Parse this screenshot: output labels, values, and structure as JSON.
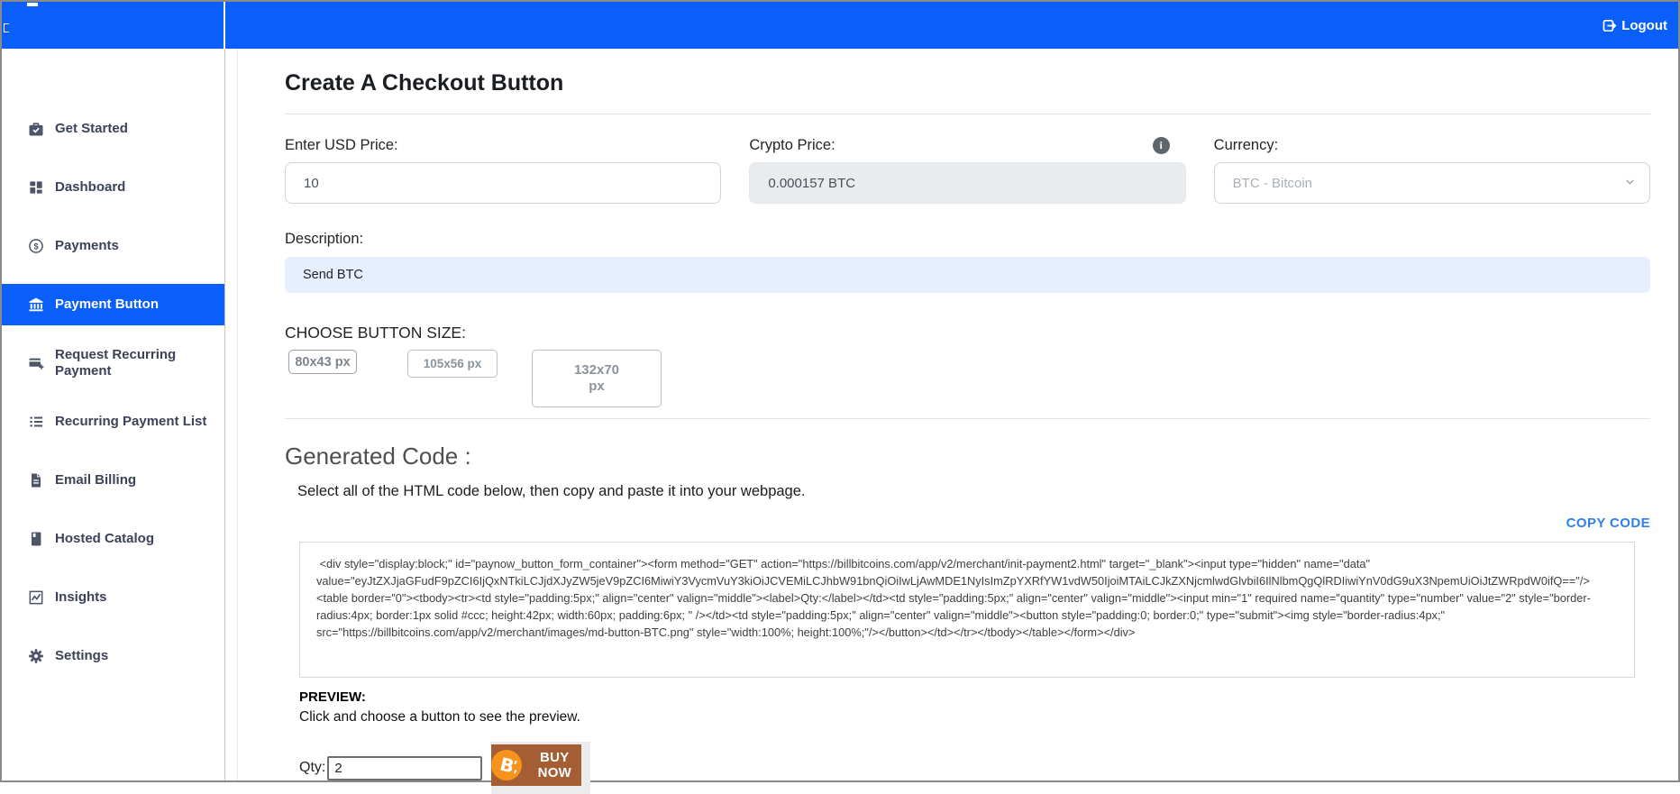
{
  "header": {
    "logout_label": "Logout",
    "bg_color": "#0a5ffa"
  },
  "sidebar": {
    "active_color": "#0a5ffa",
    "items": [
      {
        "label": "Get Started",
        "icon": "briefcase-check-icon",
        "active": false
      },
      {
        "label": "Dashboard",
        "icon": "dashboard-grid-icon",
        "active": false
      },
      {
        "label": "Payments",
        "icon": "dollar-circle-icon",
        "active": false
      },
      {
        "label": "Payment Button",
        "icon": "bank-icon",
        "active": true
      },
      {
        "label": "Request Recurring Payment",
        "icon": "card-plus-icon",
        "active": false
      },
      {
        "label": "Recurring Payment List",
        "icon": "list-icon",
        "active": false
      },
      {
        "label": "Email Billing",
        "icon": "document-icon",
        "active": false
      },
      {
        "label": "Hosted Catalog",
        "icon": "book-icon",
        "active": false
      },
      {
        "label": "Insights",
        "icon": "chart-line-icon",
        "active": false
      },
      {
        "label": "Settings",
        "icon": "gear-icon",
        "active": false
      }
    ]
  },
  "main": {
    "title": "Create A Checkout Button",
    "usd_price": {
      "label": "Enter USD Price:",
      "value": "10"
    },
    "crypto_price": {
      "label": "Crypto Price:",
      "value": "0.000157 BTC",
      "info_icon": "info-circle-icon"
    },
    "currency": {
      "label": "Currency:",
      "value": "BTC - Bitcoin"
    },
    "description": {
      "label": "Description:",
      "value": "Send BTC"
    },
    "button_size": {
      "label": "CHOOSE BUTTON SIZE:",
      "options": [
        "80x43 px",
        "105x56 px",
        "132x70 px"
      ]
    },
    "generated_code": {
      "title": "Generated Code :",
      "instruction": "Select all of the HTML code below, then copy and paste it into your webpage.",
      "copy_label": "COPY CODE",
      "copy_color": "#2f80ed",
      "code": " <div style=\"display:block;\" id=\"paynow_button_form_container\"><form method=\"GET\" action=\"https://billbitcoins.com/app/v2/merchant/init-payment2.html\" target=\"_blank\"><input type=\"hidden\" name=\"data\" value=\"eyJtZXJjaGFudF9pZCI6IjQxNTkiLCJjdXJyZW5jeV9pZCI6MiwiY3VycmVuY3kiOiJCVEMiLCJhbW91bnQiOiIwLjAwMDE1NyIsImZpYXRfYW1vdW50IjoiMTAiLCJkZXNjcmlwdGlvbiI6IlNlbmQgQlRDIiwiYnV0dG9uX3NpemUiOiJtZWRpdW0ifQ==\"/> <table border=\"0\"><tbody><tr><td style=\"padding:5px;\" align=\"center\" valign=\"middle\"><label>Qty:</label></td><td style=\"padding:5px;\" align=\"center\" valign=\"middle\"><input min=\"1\" required name=\"quantity\" type=\"number\" value=\"2\" style=\"border-radius:4px; border:1px solid #ccc; height:42px; width:60px; padding:6px; \" /></td><td style=\"padding:5px;\" align=\"center\" valign=\"middle\"><button style=\"padding:0; border:0;\" type=\"submit\"><img style=\"border-radius:4px;\" src=\"https://billbitcoins.com/app/v2/merchant/images/md-button-BTC.png\" style=\"width:100%; height:100%;\"/></button></td></tr></tbody></table></form></div>"
    },
    "preview": {
      "title": "PREVIEW:",
      "instruction": "Click and choose a button to see the preview.",
      "qty_label": "Qty:",
      "qty_value": "2",
      "buy_button_label": "BUY NOW",
      "buy_button_color": "#a55d33",
      "bitcoin_icon": "bitcoin-icon",
      "bitcoin_color": "#f7931a"
    }
  }
}
